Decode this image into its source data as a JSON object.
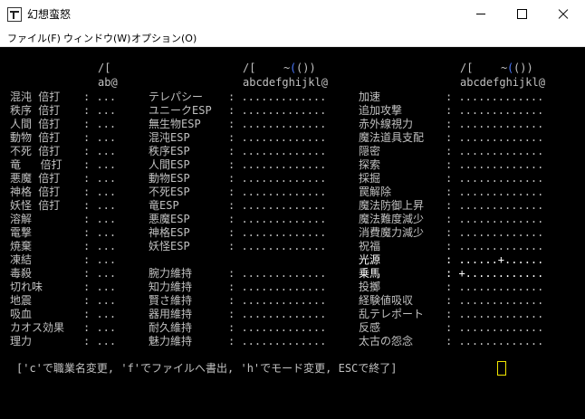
{
  "window": {
    "title": "幻想蛮怒"
  },
  "menu": [
    "ファイル(F)",
    "ウィンドウ(W)",
    "オプション(O)"
  ],
  "header": {
    "c1_slots": "/[",
    "c1_letters": "ab@",
    "c2_slots_a": "/[",
    "c2_slots_b": "~",
    "c2_slots_c": "(",
    "c2_slots_d": "())",
    "c2_letters": "abcdefghijkl@",
    "c3_slots_a": "/[",
    "c3_slots_b": "~",
    "c3_slots_c": "(",
    "c3_slots_d": "())",
    "c3_letters": "abcdefghijkl@"
  },
  "col1": [
    {
      "label": "混沌 倍打",
      "value": ": ..."
    },
    {
      "label": "秩序 倍打",
      "value": ": ..."
    },
    {
      "label": "人間 倍打",
      "value": ": ..."
    },
    {
      "label": "動物 倍打",
      "value": ": ..."
    },
    {
      "label": "不死 倍打",
      "value": ": ..."
    },
    {
      "label": "竜   倍打",
      "value": ": ..."
    },
    {
      "label": "悪魔 倍打",
      "value": ": ..."
    },
    {
      "label": "神格 倍打",
      "value": ": ..."
    },
    {
      "label": "妖怪 倍打",
      "value": ": ..."
    },
    {
      "label": "溶解",
      "value": ": ..."
    },
    {
      "label": "電撃",
      "value": ": ..."
    },
    {
      "label": "焼棄",
      "value": ": ..."
    },
    {
      "label": "凍結",
      "value": ": ..."
    },
    {
      "label": "毒殺",
      "value": ": ..."
    },
    {
      "label": "切れ味",
      "value": ": ..."
    },
    {
      "label": "地震",
      "value": ": ..."
    },
    {
      "label": "吸血",
      "value": ": ..."
    },
    {
      "label": "カオス効果",
      "value": ": ..."
    },
    {
      "label": "理力",
      "value": ": ..."
    }
  ],
  "col2": [
    {
      "label": "テレパシー",
      "value": ": ............."
    },
    {
      "label": "ユニークESP",
      "value": ": ............."
    },
    {
      "label": "無生物ESP",
      "value": ": ............."
    },
    {
      "label": "混沌ESP",
      "value": ": ............."
    },
    {
      "label": "秩序ESP",
      "value": ": ............."
    },
    {
      "label": "人間ESP",
      "value": ": ............."
    },
    {
      "label": "動物ESP",
      "value": ": ............."
    },
    {
      "label": "不死ESP",
      "value": ": ............."
    },
    {
      "label": "竜ESP",
      "value": ": ............."
    },
    {
      "label": "悪魔ESP",
      "value": ": ............."
    },
    {
      "label": "神格ESP",
      "value": ": ............."
    },
    {
      "label": "妖怪ESP",
      "value": ": ............."
    },
    {
      "label": "",
      "value": ""
    },
    {
      "label": "腕力維持",
      "value": ": ............."
    },
    {
      "label": "知力維持",
      "value": ": ............."
    },
    {
      "label": "賢さ維持",
      "value": ": ............."
    },
    {
      "label": "器用維持",
      "value": ": ............."
    },
    {
      "label": "耐久維持",
      "value": ": ............."
    },
    {
      "label": "魅力維持",
      "value": ": ............."
    }
  ],
  "col3": [
    {
      "label": "加速",
      "value": ": .............",
      "hl": false
    },
    {
      "label": "追加攻撃",
      "value": ": .............",
      "hl": false
    },
    {
      "label": "赤外線視力",
      "value": ": .............",
      "hl": false
    },
    {
      "label": "魔法道具支配",
      "value": ": .............",
      "hl": false
    },
    {
      "label": "隠密",
      "value": ": .............",
      "hl": false
    },
    {
      "label": "探索",
      "value": ": .............",
      "hl": false
    },
    {
      "label": "採掘",
      "value": ": .............",
      "hl": false
    },
    {
      "label": "罠解除",
      "value": ": .............",
      "hl": false
    },
    {
      "label": "魔法防御上昇",
      "value": ": .............",
      "hl": false
    },
    {
      "label": "魔法難度減少",
      "value": ": .............",
      "hl": false
    },
    {
      "label": "消費魔力減少",
      "value": ": .............",
      "hl": false
    },
    {
      "label": "祝福",
      "value": ": .............",
      "hl": false
    },
    {
      "label": "光源",
      "value": ": ......+......",
      "hl": true
    },
    {
      "label": "乗馬",
      "value": ": +............",
      "hl": true
    },
    {
      "label": "投擲",
      "value": ": .............",
      "hl": false
    },
    {
      "label": "経験値吸収",
      "value": ": .............",
      "hl": false
    },
    {
      "label": "乱テレポート",
      "value": ": .............",
      "hl": false
    },
    {
      "label": "反感",
      "value": ": .............",
      "hl": false
    },
    {
      "label": "太古の怨念",
      "value": ": .............",
      "hl": false
    }
  ],
  "prompt": "['c'で職業名変更, 'f'でファイルへ書出, 'h'でモード変更, ESCで終了]",
  "colors": {
    "text": "#c0c0c0",
    "highlight": "#ffffff",
    "accent": "#4a78ff",
    "cursor": "#f2e600"
  }
}
